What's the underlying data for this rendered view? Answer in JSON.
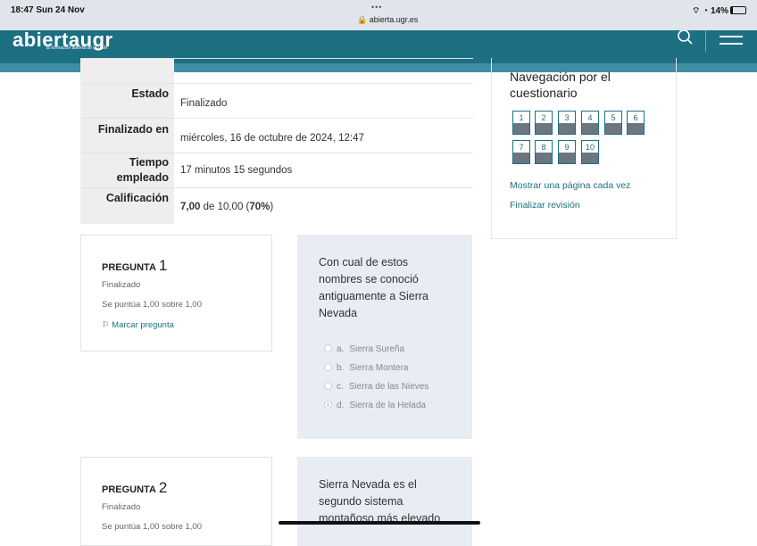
{
  "status_bar": {
    "time": "18:47  Sun 24 Nov",
    "dots": "•••",
    "url": "🔒 abierta.ugr.es",
    "system": "⌔ ◔ 14%"
  },
  "app": {
    "logo_text": "abiertaugr",
    "logo_tagline": "la formación abierta de la UGR"
  },
  "summary": {
    "rows": [
      {
        "label": "Estado",
        "value": "Finalizado"
      },
      {
        "label": "Finalizado en",
        "value": "miércoles, 16 de octubre de 2024, 12:47"
      },
      {
        "label": "Tiempo empleado",
        "value": "17 minutos 15 segundos"
      },
      {
        "label": "Calificación",
        "score": "7,00",
        "rest": " de 10,00 (",
        "pct": "70%",
        "close": ")"
      }
    ]
  },
  "navigation": {
    "title": "Navegación por el cuestionario",
    "buttons": [
      "1",
      "2",
      "3",
      "4",
      "5",
      "6",
      "7",
      "8",
      "9",
      "10"
    ],
    "show_one_page": "Mostrar una página cada vez",
    "finish_review": "Finalizar revisión"
  },
  "questions": [
    {
      "label": "PREGUNTA",
      "number": "1",
      "state": "Finalizado",
      "grade": "Se puntúa 1,00 sobre 1,00",
      "flag": "Marcar pregunta",
      "text": "Con cual de estos nombres se conoció antiguamente a Sierra Nevada",
      "options": [
        {
          "letter": "a.",
          "text": "Sierra Sureña"
        },
        {
          "letter": "b.",
          "text": "Sierra Montera"
        },
        {
          "letter": "c.",
          "text": "Sierra de las Nieves"
        },
        {
          "letter": "d.",
          "text": "Sierra de la Helada"
        }
      ],
      "selected_option": "d."
    },
    {
      "label": "PREGUNTA",
      "number": "2",
      "state": "Finalizado",
      "grade": "Se puntúa 1,00 sobre 1,00",
      "text": "Sierra Nevada es el segundo sistema montañoso más elevado"
    }
  ],
  "colors": {
    "accent": "#1d6f82",
    "header": "#1d6f82",
    "question_bg": "#e7ecf5"
  }
}
